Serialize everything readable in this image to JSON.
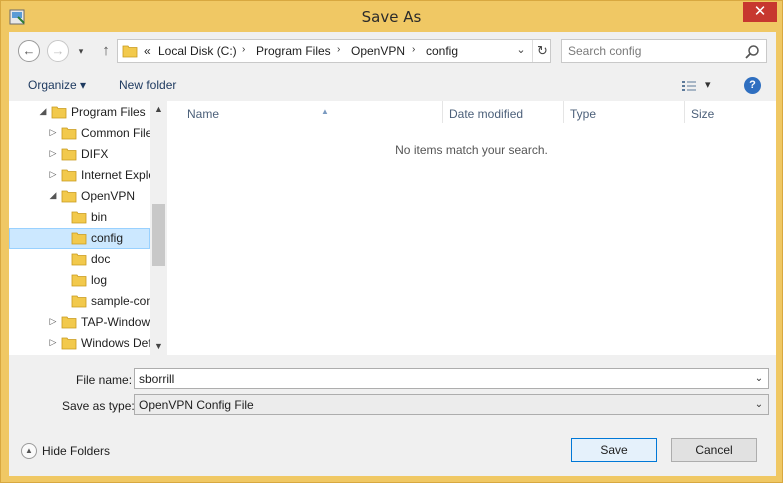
{
  "window": {
    "title": "Save As",
    "close_glyph": "✕",
    "frame_color": "#f0c864",
    "close_color": "#c7372f"
  },
  "nav": {
    "back_glyph": "←",
    "forward_glyph": "→",
    "recent_glyph": "▾",
    "up_glyph": "↑"
  },
  "address": {
    "overflow": "«",
    "crumbs": [
      "Local Disk (C:)",
      "Program Files",
      "OpenVPN",
      "config"
    ],
    "separator": "›",
    "dropdown_glyph": "⌄",
    "refresh_glyph": "↻"
  },
  "search": {
    "placeholder": "Search config",
    "value": ""
  },
  "commands": {
    "organize": "Organize ▾",
    "new_folder": "New folder",
    "views_glyph": "▾",
    "help": "?"
  },
  "tree": {
    "items": [
      {
        "label": "Program Files",
        "arrow": "◢",
        "indent": 0
      },
      {
        "label": "Common Files",
        "arrow": "▷",
        "indent": 1
      },
      {
        "label": "DIFX",
        "arrow": "▷",
        "indent": 1
      },
      {
        "label": "Internet Explorer",
        "arrow": "▷",
        "indent": 1
      },
      {
        "label": "OpenVPN",
        "arrow": "◢",
        "indent": 1
      },
      {
        "label": "bin",
        "arrow": "",
        "indent": 2
      },
      {
        "label": "config",
        "arrow": "",
        "indent": 2,
        "selected": true
      },
      {
        "label": "doc",
        "arrow": "",
        "indent": 2
      },
      {
        "label": "log",
        "arrow": "",
        "indent": 2
      },
      {
        "label": "sample-config",
        "arrow": "",
        "indent": 2
      },
      {
        "label": "TAP-Windows",
        "arrow": "▷",
        "indent": 1
      },
      {
        "label": "Windows Defender",
        "arrow": "▷",
        "indent": 1
      }
    ],
    "scroll_up": "▲",
    "scroll_down": "▼"
  },
  "list": {
    "columns": [
      "Name",
      "Date modified",
      "Type",
      "Size"
    ],
    "sort_glyph": "▲",
    "empty_message": "No items match your search."
  },
  "form": {
    "file_name_label": "File name:",
    "file_name_value": "sborrill",
    "save_type_label": "Save as type:",
    "save_type_value": "OpenVPN Config File",
    "combo_glyph": "⌄"
  },
  "footer": {
    "hide_folders_glyph": "▲",
    "hide_folders": "Hide Folders",
    "save": "Save",
    "cancel": "Cancel"
  }
}
